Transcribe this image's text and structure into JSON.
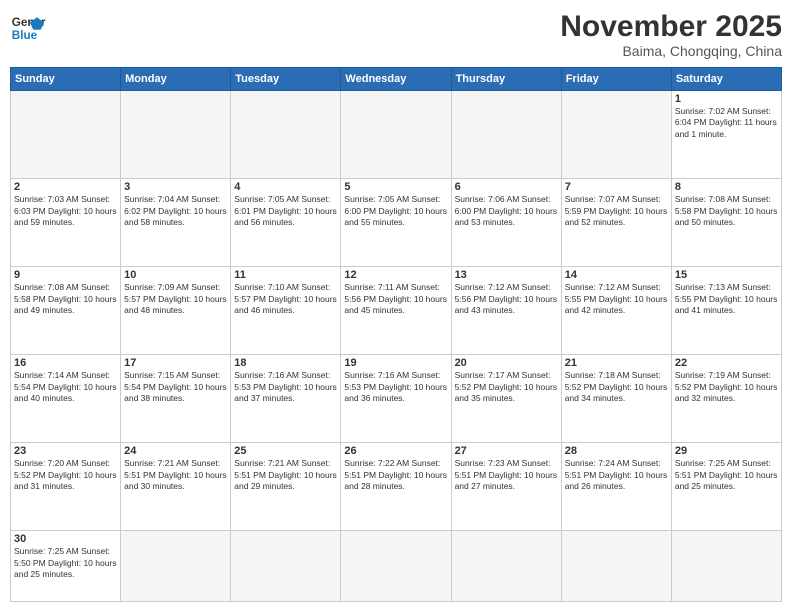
{
  "header": {
    "logo_general": "General",
    "logo_blue": "Blue",
    "month": "November 2025",
    "location": "Baima, Chongqing, China"
  },
  "weekdays": [
    "Sunday",
    "Monday",
    "Tuesday",
    "Wednesday",
    "Thursday",
    "Friday",
    "Saturday"
  ],
  "weeks": [
    [
      {
        "day": "",
        "info": ""
      },
      {
        "day": "",
        "info": ""
      },
      {
        "day": "",
        "info": ""
      },
      {
        "day": "",
        "info": ""
      },
      {
        "day": "",
        "info": ""
      },
      {
        "day": "",
        "info": ""
      },
      {
        "day": "1",
        "info": "Sunrise: 7:02 AM\nSunset: 6:04 PM\nDaylight: 11 hours\nand 1 minute."
      }
    ],
    [
      {
        "day": "2",
        "info": "Sunrise: 7:03 AM\nSunset: 6:03 PM\nDaylight: 10 hours\nand 59 minutes."
      },
      {
        "day": "3",
        "info": "Sunrise: 7:04 AM\nSunset: 6:02 PM\nDaylight: 10 hours\nand 58 minutes."
      },
      {
        "day": "4",
        "info": "Sunrise: 7:05 AM\nSunset: 6:01 PM\nDaylight: 10 hours\nand 56 minutes."
      },
      {
        "day": "5",
        "info": "Sunrise: 7:05 AM\nSunset: 6:00 PM\nDaylight: 10 hours\nand 55 minutes."
      },
      {
        "day": "6",
        "info": "Sunrise: 7:06 AM\nSunset: 6:00 PM\nDaylight: 10 hours\nand 53 minutes."
      },
      {
        "day": "7",
        "info": "Sunrise: 7:07 AM\nSunset: 5:59 PM\nDaylight: 10 hours\nand 52 minutes."
      },
      {
        "day": "8",
        "info": "Sunrise: 7:08 AM\nSunset: 5:58 PM\nDaylight: 10 hours\nand 50 minutes."
      }
    ],
    [
      {
        "day": "9",
        "info": "Sunrise: 7:08 AM\nSunset: 5:58 PM\nDaylight: 10 hours\nand 49 minutes."
      },
      {
        "day": "10",
        "info": "Sunrise: 7:09 AM\nSunset: 5:57 PM\nDaylight: 10 hours\nand 48 minutes."
      },
      {
        "day": "11",
        "info": "Sunrise: 7:10 AM\nSunset: 5:57 PM\nDaylight: 10 hours\nand 46 minutes."
      },
      {
        "day": "12",
        "info": "Sunrise: 7:11 AM\nSunset: 5:56 PM\nDaylight: 10 hours\nand 45 minutes."
      },
      {
        "day": "13",
        "info": "Sunrise: 7:12 AM\nSunset: 5:56 PM\nDaylight: 10 hours\nand 43 minutes."
      },
      {
        "day": "14",
        "info": "Sunrise: 7:12 AM\nSunset: 5:55 PM\nDaylight: 10 hours\nand 42 minutes."
      },
      {
        "day": "15",
        "info": "Sunrise: 7:13 AM\nSunset: 5:55 PM\nDaylight: 10 hours\nand 41 minutes."
      }
    ],
    [
      {
        "day": "16",
        "info": "Sunrise: 7:14 AM\nSunset: 5:54 PM\nDaylight: 10 hours\nand 40 minutes."
      },
      {
        "day": "17",
        "info": "Sunrise: 7:15 AM\nSunset: 5:54 PM\nDaylight: 10 hours\nand 38 minutes."
      },
      {
        "day": "18",
        "info": "Sunrise: 7:16 AM\nSunset: 5:53 PM\nDaylight: 10 hours\nand 37 minutes."
      },
      {
        "day": "19",
        "info": "Sunrise: 7:16 AM\nSunset: 5:53 PM\nDaylight: 10 hours\nand 36 minutes."
      },
      {
        "day": "20",
        "info": "Sunrise: 7:17 AM\nSunset: 5:52 PM\nDaylight: 10 hours\nand 35 minutes."
      },
      {
        "day": "21",
        "info": "Sunrise: 7:18 AM\nSunset: 5:52 PM\nDaylight: 10 hours\nand 34 minutes."
      },
      {
        "day": "22",
        "info": "Sunrise: 7:19 AM\nSunset: 5:52 PM\nDaylight: 10 hours\nand 32 minutes."
      }
    ],
    [
      {
        "day": "23",
        "info": "Sunrise: 7:20 AM\nSunset: 5:52 PM\nDaylight: 10 hours\nand 31 minutes."
      },
      {
        "day": "24",
        "info": "Sunrise: 7:21 AM\nSunset: 5:51 PM\nDaylight: 10 hours\nand 30 minutes."
      },
      {
        "day": "25",
        "info": "Sunrise: 7:21 AM\nSunset: 5:51 PM\nDaylight: 10 hours\nand 29 minutes."
      },
      {
        "day": "26",
        "info": "Sunrise: 7:22 AM\nSunset: 5:51 PM\nDaylight: 10 hours\nand 28 minutes."
      },
      {
        "day": "27",
        "info": "Sunrise: 7:23 AM\nSunset: 5:51 PM\nDaylight: 10 hours\nand 27 minutes."
      },
      {
        "day": "28",
        "info": "Sunrise: 7:24 AM\nSunset: 5:51 PM\nDaylight: 10 hours\nand 26 minutes."
      },
      {
        "day": "29",
        "info": "Sunrise: 7:25 AM\nSunset: 5:51 PM\nDaylight: 10 hours\nand 25 minutes."
      }
    ],
    [
      {
        "day": "30",
        "info": "Sunrise: 7:25 AM\nSunset: 5:50 PM\nDaylight: 10 hours\nand 25 minutes."
      },
      {
        "day": "",
        "info": ""
      },
      {
        "day": "",
        "info": ""
      },
      {
        "day": "",
        "info": ""
      },
      {
        "day": "",
        "info": ""
      },
      {
        "day": "",
        "info": ""
      },
      {
        "day": "",
        "info": ""
      }
    ]
  ]
}
